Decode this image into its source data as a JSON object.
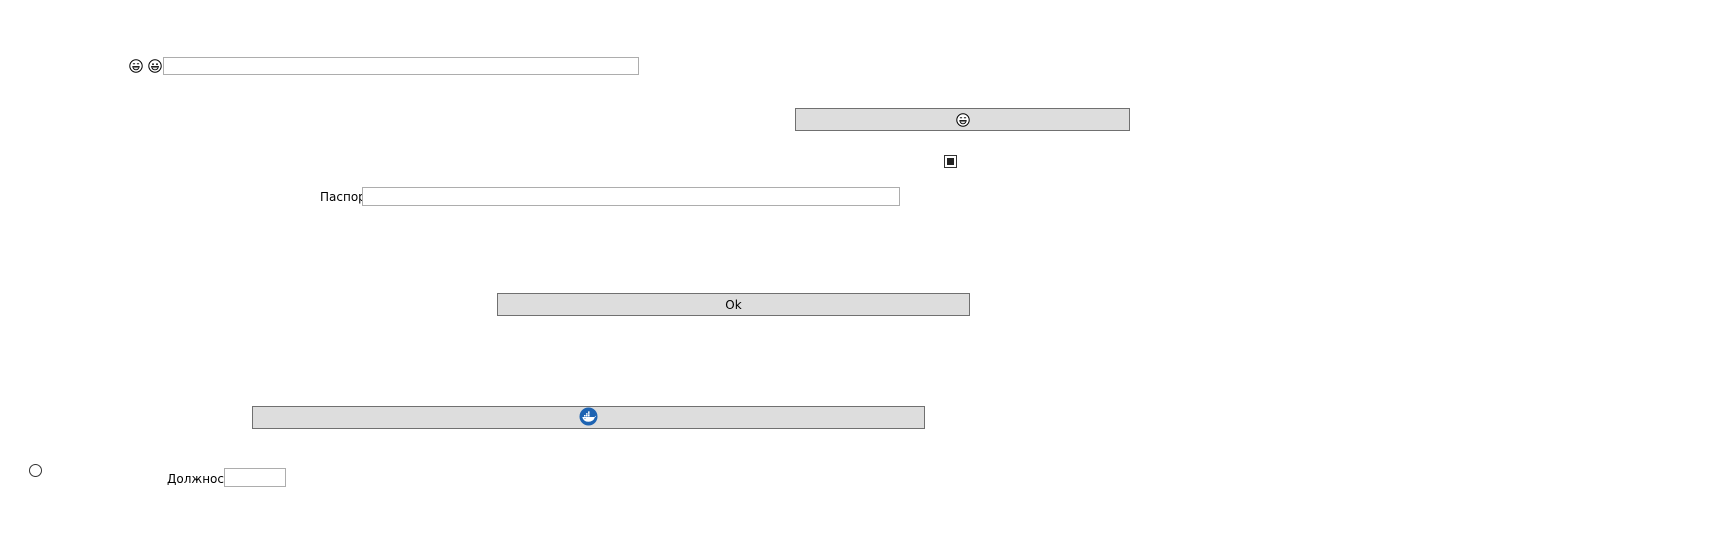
{
  "window": {
    "background_color": "#ffffff"
  },
  "row1": {
    "icons": [
      "grinning-face-sweat-icon",
      "grinning-face-icon"
    ],
    "input_value": ""
  },
  "emoji_button": {
    "icon": "grinning-face-sweat-icon"
  },
  "checkbox": {
    "checked": true
  },
  "passport": {
    "label": "Паспорт",
    "value": ""
  },
  "ok_button": {
    "label": "Ok"
  },
  "docker_button": {
    "icon": "docker-whale-icon",
    "icon_color": "#1d63b2"
  },
  "radio": {
    "checked": false
  },
  "position": {
    "label": "Должность",
    "value": ""
  },
  "colors": {
    "button_face": "#dddddd",
    "button_border": "#707070",
    "field_border": "#adadad"
  }
}
